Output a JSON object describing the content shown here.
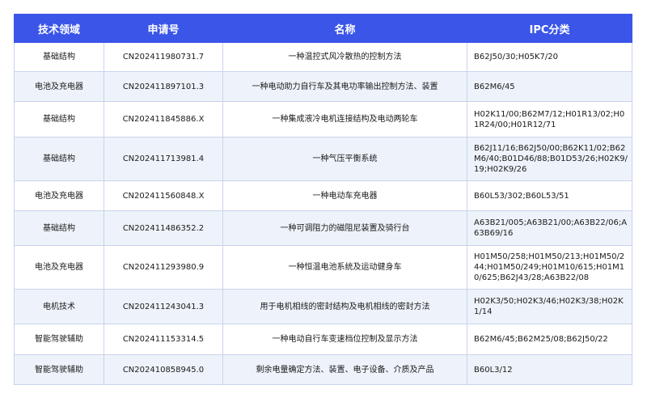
{
  "headers": [
    "技术领域",
    "申请号",
    "名称",
    "IPC分类"
  ],
  "rows": [
    {
      "field": "基础结构",
      "app_no": "CN202411980731.7",
      "name": "一种温控式风冷散热的控制方法",
      "ipc": "B62J50/30;H05K7/20"
    },
    {
      "field": "电池及充电器",
      "app_no": "CN202411897101.3",
      "name": "一种电动助力自行车及其电功率输出控制方法、装置",
      "ipc": "B62M6/45"
    },
    {
      "field": "基础结构",
      "app_no": "CN202411845886.X",
      "name": "一种集成液冷电机连接结构及电动两轮车",
      "ipc": "H02K11/00;B62M7/12;H01R13/02;H01R24/00;H01R12/71"
    },
    {
      "field": "基础结构",
      "app_no": "CN202411713981.4",
      "name": "一种气压平衡系统",
      "ipc": "B62J11/16;B62J50/00;B62K11/02;B62M6/40;B01D46/88;B01D53/26;H02K9/19;H02K9/26"
    },
    {
      "field": "电池及充电器",
      "app_no": "CN202411560848.X",
      "name": "一种电动车充电器",
      "ipc": "B60L53/302;B60L53/51"
    },
    {
      "field": "基础结构",
      "app_no": "CN202411486352.2",
      "name": "一种可调阻力的磁阻尼装置及骑行台",
      "ipc": "A63B21/005;A63B21/00;A63B22/06;A63B69/16"
    },
    {
      "field": "电池及充电器",
      "app_no": "CN202411293980.9",
      "name": "一种恒温电池系统及运动健身车",
      "ipc": "H01M50/258;H01M50/213;H01M50/244;H01M50/249;H01M10/615;H01M10/625;B62J43/28;A63B22/08"
    },
    {
      "field": "电机技术",
      "app_no": "CN202411243041.3",
      "name": "用于电机相线的密封结构及电机相线的密封方法",
      "ipc": "H02K3/50;H02K3/46;H02K3/38;H02K1/14"
    },
    {
      "field": "智能驾驶辅助",
      "app_no": "CN202411153314.5",
      "name": "一种电动自行车变速档位控制及显示方法",
      "ipc": "B62M6/45;B62M25/08;B62J50/22"
    },
    {
      "field": "智能驾驶辅助",
      "app_no": "CN202410858945.0",
      "name": "剩余电量确定方法、装置、电子设备、介质及产品",
      "ipc": "B60L3/12"
    }
  ],
  "colors": {
    "header_bg": "#3a55e8",
    "alt_row_bg": "#eef3fb",
    "border": "#c9d3ea"
  }
}
